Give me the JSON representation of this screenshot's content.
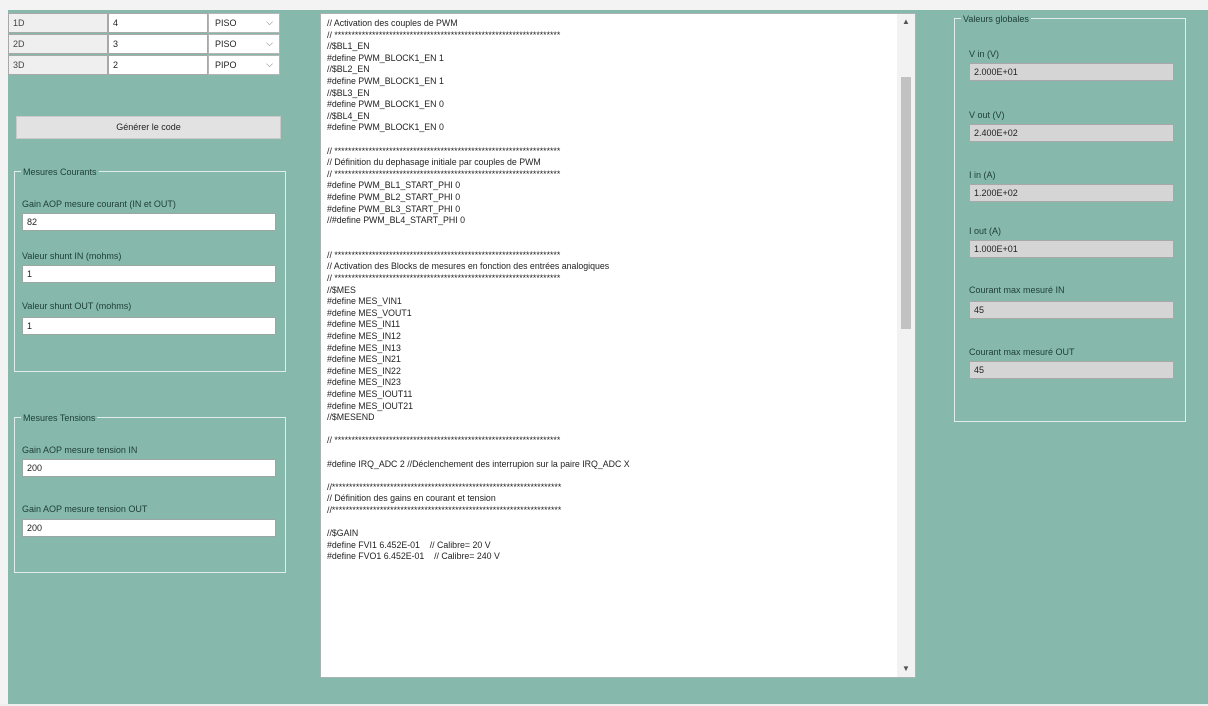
{
  "table": {
    "rows": [
      {
        "name": "1D",
        "value": "4",
        "mode": "PISO"
      },
      {
        "name": "2D",
        "value": "3",
        "mode": "PISO"
      },
      {
        "name": "3D",
        "value": "2",
        "mode": "PIPO"
      }
    ]
  },
  "generate_button": "Générer le code",
  "mesures_courants": {
    "title": "Mesures Courants",
    "gain_label": "Gain AOP mesure courant (IN et OUT)",
    "gain_value": "82",
    "shunt_in_label": "Valeur shunt IN (mohms)",
    "shunt_in_value": "1",
    "shunt_out_label": "Valeur shunt OUT (mohms)",
    "shunt_out_value": "1"
  },
  "mesures_tensions": {
    "title": "Mesures Tensions",
    "gain_in_label": "Gain AOP mesure tension IN",
    "gain_in_value": "200",
    "gain_out_label": "Gain AOP mesure tension OUT",
    "gain_out_value": "200"
  },
  "valeurs_globales": {
    "title": "Valeurs globales",
    "items": [
      {
        "label": "V in (V)",
        "value": "2.000E+01"
      },
      {
        "label": "V out (V)",
        "value": "2.400E+02"
      },
      {
        "label": "I in (A)",
        "value": "1.200E+02"
      },
      {
        "label": "I out (A)",
        "value": "1.000E+01"
      },
      {
        "label": "Courant max mesuré IN",
        "value": "45"
      },
      {
        "label": "Courant max mesuré OUT",
        "value": "45"
      }
    ]
  },
  "code_lines": [
    "// Activation des couples de PWM",
    "// ******************************************************************",
    "//$BL1_EN",
    "#define PWM_BLOCK1_EN 1",
    "//$BL2_EN",
    "#define PWM_BLOCK1_EN 1",
    "//$BL3_EN",
    "#define PWM_BLOCK1_EN 0",
    "//$BL4_EN",
    "#define PWM_BLOCK1_EN 0",
    "",
    "// ******************************************************************",
    "// Définition du dephasage initiale par couples de PWM",
    "// ******************************************************************",
    "#define PWM_BL1_START_PHI 0",
    "#define PWM_BL2_START_PHI 0",
    "#define PWM_BL3_START_PHI 0",
    "//#define PWM_BL4_START_PHI 0",
    "",
    "",
    "// ******************************************************************",
    "// Activation des Blocks de mesures en fonction des entrées analogiques",
    "// ******************************************************************",
    "//$MES",
    "#define MES_VIN1",
    "#define MES_VOUT1",
    "#define MES_IN11",
    "#define MES_IN12",
    "#define MES_IN13",
    "#define MES_IN21",
    "#define MES_IN22",
    "#define MES_IN23",
    "#define MES_IOUT11",
    "#define MES_IOUT21",
    "//$MESEND",
    "",
    "// ******************************************************************",
    "",
    "#define IRQ_ADC 2 //Déclenchement des interrupion sur la paire IRQ_ADC X",
    "",
    "//*******************************************************************",
    "// Définition des gains en courant et tension",
    "//*******************************************************************",
    "",
    "//$GAIN",
    "#define FVI1 6.452E-01    // Calibre= 20 V",
    "#define FVO1 6.452E-01    // Calibre= 240 V"
  ]
}
